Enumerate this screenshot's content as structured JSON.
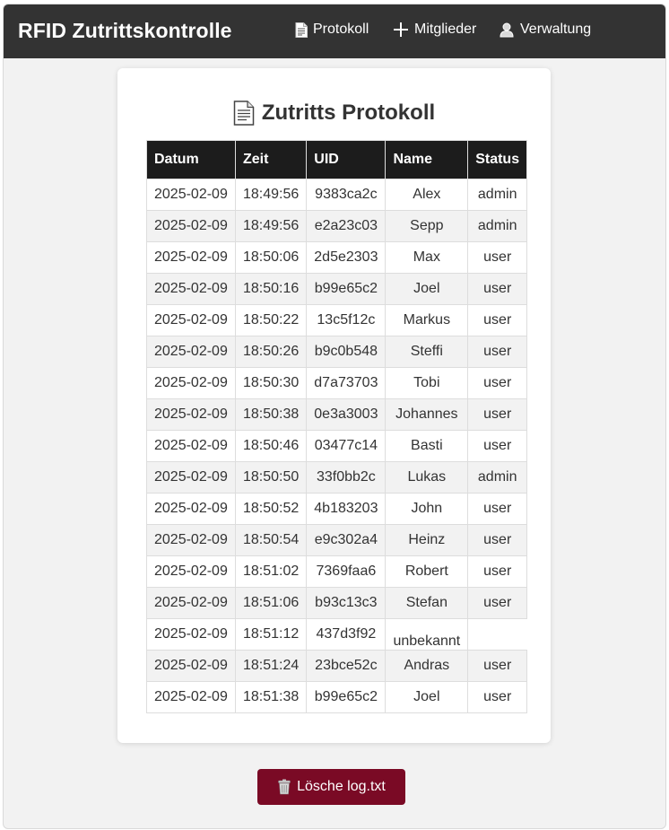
{
  "navbar": {
    "brand": "RFID Zutrittskontrolle",
    "items": [
      {
        "label": "Protokoll",
        "icon": "document-icon"
      },
      {
        "label": "Mitglieder",
        "icon": "plus-icon"
      },
      {
        "label": "Verwaltung",
        "icon": "user-icon"
      }
    ]
  },
  "page": {
    "title": "Zutritts Protokoll",
    "title_icon": "document-icon"
  },
  "table": {
    "columns": [
      "Datum",
      "Zeit",
      "UID",
      "Name",
      "Status"
    ],
    "rows": [
      [
        "2025-02-09",
        "18:49:56",
        "9383ca2c",
        "Alex",
        "admin"
      ],
      [
        "2025-02-09",
        "18:49:56",
        "e2a23c03",
        "Sepp",
        "admin"
      ],
      [
        "2025-02-09",
        "18:50:06",
        "2d5e2303",
        "Max",
        "user"
      ],
      [
        "2025-02-09",
        "18:50:16",
        "b99e65c2",
        "Joel",
        "user"
      ],
      [
        "2025-02-09",
        "18:50:22",
        "13c5f12c",
        "Markus",
        "user"
      ],
      [
        "2025-02-09",
        "18:50:26",
        "b9c0b548",
        "Steffi",
        "user"
      ],
      [
        "2025-02-09",
        "18:50:30",
        "d7a73703",
        "Tobi",
        "user"
      ],
      [
        "2025-02-09",
        "18:50:38",
        "0e3a3003",
        "Johannes",
        "user"
      ],
      [
        "2025-02-09",
        "18:50:46",
        "03477c14",
        "Basti",
        "user"
      ],
      [
        "2025-02-09",
        "18:50:50",
        "33f0bb2c",
        "Lukas",
        "admin"
      ],
      [
        "2025-02-09",
        "18:50:52",
        "4b183203",
        "John",
        "user"
      ],
      [
        "2025-02-09",
        "18:50:54",
        "e9c302a4",
        "Heinz",
        "user"
      ],
      [
        "2025-02-09",
        "18:51:02",
        "7369faa6",
        "Robert",
        "user"
      ],
      [
        "2025-02-09",
        "18:51:06",
        "b93c13c3",
        "Stefan",
        "user"
      ],
      [
        "2025-02-09",
        "18:51:12",
        "437d3f92",
        "unbekannt",
        ""
      ],
      [
        "2025-02-09",
        "18:51:24",
        "23bce52c",
        "Andras",
        "user"
      ],
      [
        "2025-02-09",
        "18:51:38",
        "b99e65c2",
        "Joel",
        "user"
      ]
    ]
  },
  "actions": {
    "delete_label": "Lösche log.txt",
    "delete_icon": "trash-icon",
    "delete_color": "#7a0a25"
  },
  "colors": {
    "navbar_bg": "#333333",
    "table_header_bg": "#1c1c1c",
    "page_bg": "#f2f2f2"
  }
}
